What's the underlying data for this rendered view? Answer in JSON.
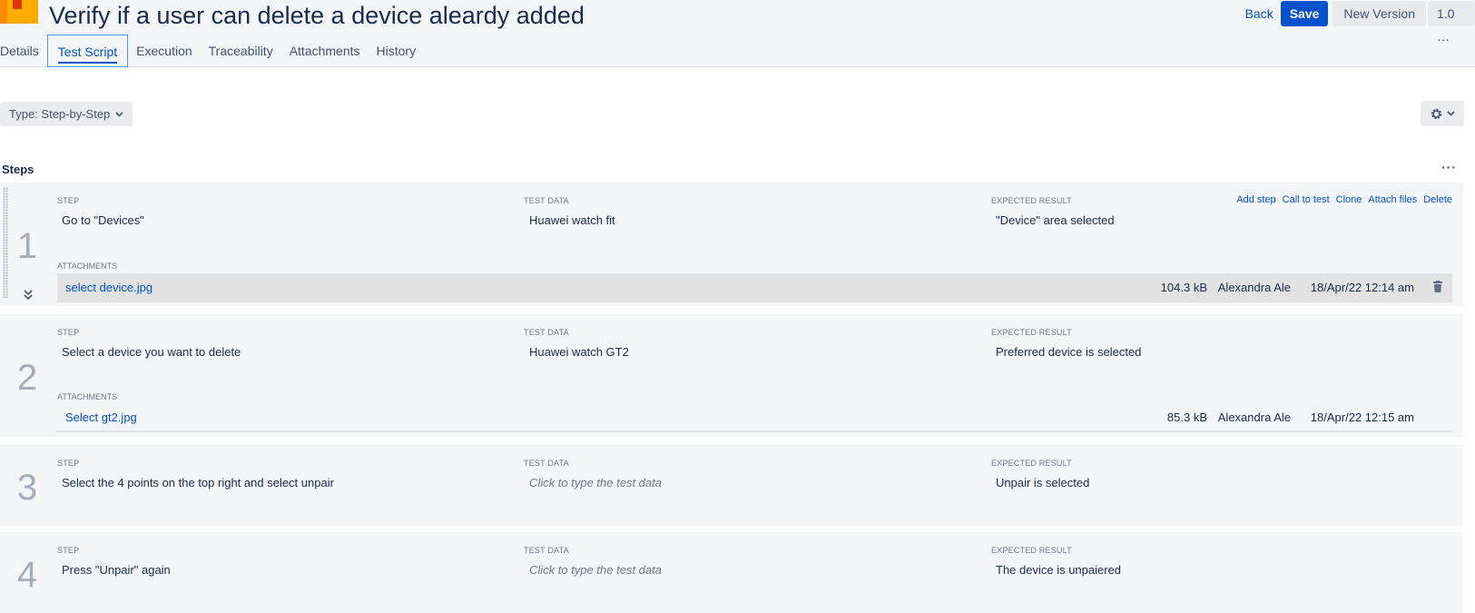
{
  "header": {
    "title": "Verify if a user can delete a device aleardy added",
    "back_label": "Back",
    "save_label": "Save",
    "new_version_label": "New Version",
    "version_label": "1.0 ···"
  },
  "tabs": [
    {
      "label": "Details"
    },
    {
      "label": "Test Script"
    },
    {
      "label": "Execution"
    },
    {
      "label": "Traceability"
    },
    {
      "label": "Attachments"
    },
    {
      "label": "History"
    }
  ],
  "toolbar": {
    "type_label": "Type: Step-by-Step",
    "settings_icon": "gear-icon"
  },
  "steps_section": {
    "title": "Steps",
    "more": "···",
    "col_step": "STEP",
    "col_test_data": "TEST DATA",
    "col_expected": "EXPECTED RESULT",
    "attachments_label": "ATTACHMENTS",
    "actions": [
      "Add step",
      "Call to test",
      "Clone",
      "Attach files",
      "Delete"
    ]
  },
  "steps": [
    {
      "number": "1",
      "step": "Go to \"Devices\"",
      "test_data": "Huawei watch fit",
      "expected": "\"Device\" area selected",
      "attachment": {
        "name": "select device.jpg",
        "size": "104.3 kB",
        "author": "Alexandra Ale",
        "date": "18/Apr/22 12:14 am"
      }
    },
    {
      "number": "2",
      "step": "Select a device you want to delete",
      "test_data": "Huawei watch GT2",
      "expected": "Preferred device is selected",
      "attachment": {
        "name": "Select gt2.jpg",
        "size": "85.3 kB",
        "author": "Alexandra Ale",
        "date": "18/Apr/22 12:15 am"
      }
    },
    {
      "number": "3",
      "step": "Select the 4 points on the top right and select unpair",
      "test_data": "Click to type the test data",
      "expected": "Unpair is selected"
    },
    {
      "number": "4",
      "step": "Press \"Unpair\" again",
      "test_data": "Click to type the test data",
      "expected": "The device is unpaiered"
    }
  ],
  "colors": {
    "accent": "#0052cc",
    "row_bg": "#f4f5f7",
    "issue_icon": "#ffab00"
  }
}
